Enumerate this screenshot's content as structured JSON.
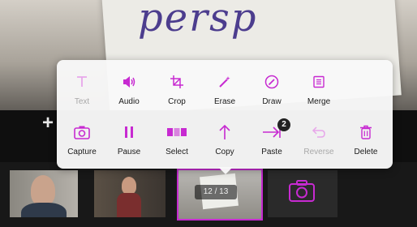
{
  "background": {
    "handwriting": "persp"
  },
  "menu": {
    "row1": [
      {
        "label": "Text",
        "icon": "text-icon",
        "disabled": true
      },
      {
        "label": "Audio",
        "icon": "speaker-icon",
        "disabled": false
      },
      {
        "label": "Crop",
        "icon": "crop-icon",
        "disabled": false
      },
      {
        "label": "Erase",
        "icon": "magic-wand-icon",
        "disabled": false
      },
      {
        "label": "Draw",
        "icon": "pencil-circle-icon",
        "disabled": false
      },
      {
        "label": "Merge",
        "icon": "merge-doc-icon",
        "disabled": false
      }
    ],
    "row2": [
      {
        "label": "Capture",
        "icon": "camera-icon",
        "disabled": false
      },
      {
        "label": "Pause",
        "icon": "pause-icon",
        "disabled": false
      },
      {
        "label": "Select",
        "icon": "select-frames-icon",
        "disabled": false
      },
      {
        "label": "Copy",
        "icon": "arrow-up-icon",
        "disabled": false
      },
      {
        "label": "Paste",
        "icon": "paste-arrow-icon",
        "disabled": false,
        "badge": "2"
      },
      {
        "label": "Reverse",
        "icon": "undo-arrow-icon",
        "disabled": true
      },
      {
        "label": "Delete",
        "icon": "trash-icon",
        "disabled": false
      }
    ]
  },
  "filmstrip": {
    "counter": "12 / 13"
  },
  "colors": {
    "accent": "#c72ad1",
    "disabled": "#e7a6ea"
  }
}
